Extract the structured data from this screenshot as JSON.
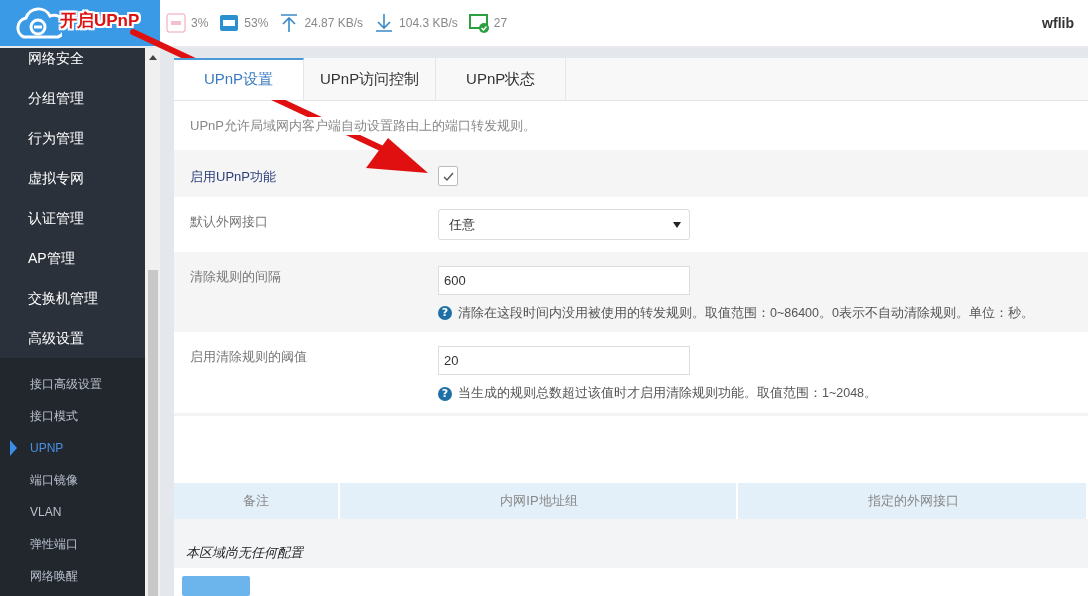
{
  "header": {
    "stats": [
      {
        "kind": "cpu",
        "text": "3%"
      },
      {
        "kind": "ram",
        "text": "53%"
      },
      {
        "kind": "upload",
        "text": "24.87 KB/s"
      },
      {
        "kind": "download",
        "text": "104.3 KB/s"
      },
      {
        "kind": "clients",
        "text": "27"
      }
    ],
    "user": "wflib"
  },
  "sidebar": {
    "items": [
      {
        "label": "网络安全"
      },
      {
        "label": "分组管理"
      },
      {
        "label": "行为管理"
      },
      {
        "label": "虚拟专网"
      },
      {
        "label": "认证管理"
      },
      {
        "label": "AP管理"
      },
      {
        "label": "交换机管理"
      },
      {
        "label": "高级设置",
        "expanded": true,
        "children": [
          {
            "label": "接口高级设置",
            "selected": false
          },
          {
            "label": "接口模式",
            "selected": false
          },
          {
            "label": "UPNP",
            "selected": true
          },
          {
            "label": "端口镜像",
            "selected": false
          },
          {
            "label": "VLAN",
            "selected": false
          },
          {
            "label": "弹性端口",
            "selected": false
          },
          {
            "label": "网络唤醒",
            "selected": false
          }
        ]
      }
    ]
  },
  "tabs": [
    {
      "label": "UPnP设置",
      "selected": true
    },
    {
      "label": "UPnP访问控制",
      "selected": false
    },
    {
      "label": "UPnP状态",
      "selected": false
    }
  ],
  "description": "UPnP允许局域网内客户端自动设置路由上的端口转发规则。",
  "form": [
    {
      "kind": "checkbox",
      "label": "启用UPnP功能",
      "checked": true
    },
    {
      "kind": "select",
      "label": "默认外网接口",
      "value": "任意"
    },
    {
      "kind": "text",
      "label": "清除规则的间隔",
      "value": "600",
      "help_icon": "?",
      "help": "清除在这段时间内没用被使用的转发规则。取值范围：0~86400。0表示不自动清除规则。单位：秒。"
    },
    {
      "kind": "text",
      "label": "启用清除规则的阈值",
      "value": "20",
      "help_icon": "?",
      "help": "当生成的规则总数超过该值时才启用清除规则功能。取值范围：1~2048。"
    }
  ],
  "table": {
    "columns": [
      "备注",
      "内网IP地址组",
      "指定的外网接口"
    ],
    "empty_message": "本区域尚无任何配置"
  },
  "annotation": {
    "label": "开启UPnP"
  }
}
